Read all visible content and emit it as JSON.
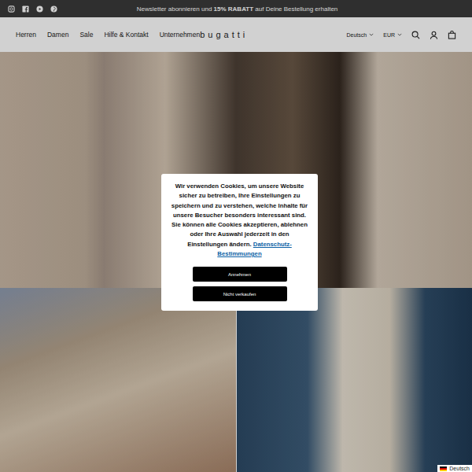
{
  "announcement": {
    "parts": [
      {
        "text": "Newsletter abonnieren und ",
        "bold": false
      },
      {
        "text": "15% RABATT",
        "bold": true
      },
      {
        "text": " auf Deine Bestellung erhalten",
        "bold": false
      }
    ]
  },
  "nav": [
    "Herren",
    "Damen",
    "Sale",
    "Hilfe & Kontakt",
    "Unternehmen"
  ],
  "logo": "bugatti",
  "selectors": [
    "Deutsch",
    "EUR"
  ],
  "cookie_dialog": {
    "text": "Wir verwenden Cookies, um unsere Website sicher zu betreiben, Ihre Einstellungen zu speichern und zu verstehen, welche Inhalte für unsere Besucher besonders interessant sind. Sie können alle Cookies akzeptieren, ablehnen oder Ihre Auswahl jederzeit in den Einstellungen ändern.",
    "link": "Datenschutz-Bestimmungen",
    "buttons": [
      "Annehmen",
      "Nicht verkaufen"
    ]
  },
  "language_badge": "Deutsch"
}
